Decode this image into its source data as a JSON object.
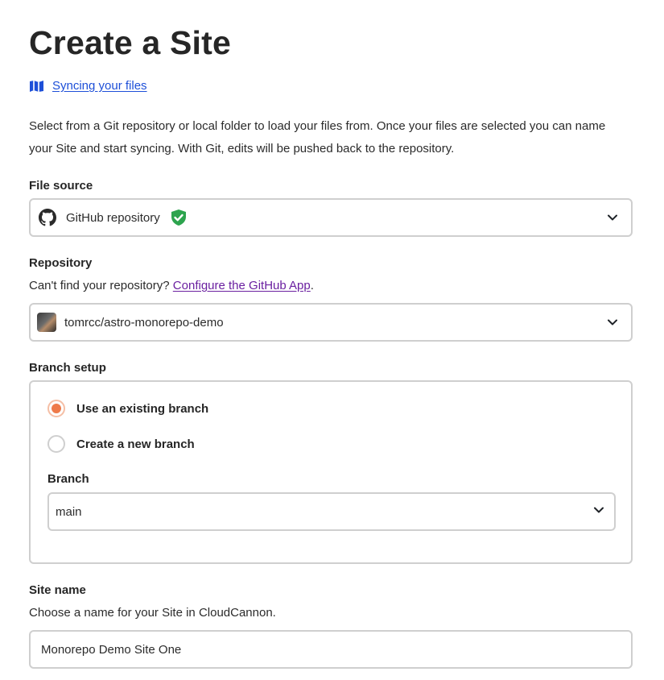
{
  "page": {
    "title": "Create a Site"
  },
  "doc_link": {
    "icon": "book-map-icon",
    "label": "Syncing your files"
  },
  "intro_text": "Select from a Git repository or local folder to load your files from. Once your files are selected you can name your Site and start syncing. With Git, edits will be pushed back to the repository.",
  "file_source": {
    "label": "File source",
    "selected": "GitHub repository",
    "icon": "github-icon",
    "status_icon": "verified-shield-icon",
    "status_color": "#2da44e"
  },
  "repository": {
    "label": "Repository",
    "helper_prefix": "Can't find your repository? ",
    "helper_link": "Configure the GitHub App",
    "helper_suffix": ".",
    "selected": "tomrcc/astro-monorepo-demo"
  },
  "branch_setup": {
    "label": "Branch setup",
    "options": [
      {
        "label": "Use an existing branch",
        "checked": true
      },
      {
        "label": "Create a new branch",
        "checked": false
      }
    ],
    "branch_label": "Branch",
    "branch_selected": "main",
    "accent_color": "#ee7a4a"
  },
  "site_name": {
    "label": "Site name",
    "helper": "Choose a name for your Site in CloudCannon.",
    "value": "Monorepo Demo Site One"
  }
}
